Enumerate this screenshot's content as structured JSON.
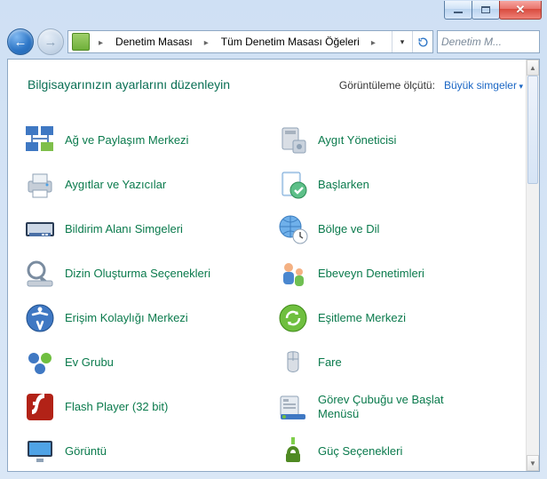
{
  "breadcrumb": {
    "seg1": "Denetim Masası",
    "seg2": "Tüm Denetim Masası Öğeleri"
  },
  "search": {
    "placeholder": "Denetim M..."
  },
  "header": {
    "title": "Bilgisayarınızın ayarlarını düzenleyin",
    "view_label": "Görüntüleme ölçütü:",
    "view_value": "Büyük simgeler"
  },
  "items": {
    "c0": "Ağ ve Paylaşım Merkezi",
    "c1": "Aygıt Yöneticisi",
    "c2": "Aygıtlar ve Yazıcılar",
    "c3": "Başlarken",
    "c4": "Bildirim Alanı Simgeleri",
    "c5": "Bölge ve Dil",
    "c6": "Dizin Oluşturma Seçenekleri",
    "c7": "Ebeveyn Denetimleri",
    "c8": "Erişim Kolaylığı Merkezi",
    "c9": "Eşitleme Merkezi",
    "c10": "Ev Grubu",
    "c11": "Fare",
    "c12": "Flash Player (32 bit)",
    "c13": "Görev Çubuğu ve Başlat Menüsü",
    "c14": "Görüntü",
    "c15": "Güç Seçenekleri"
  }
}
